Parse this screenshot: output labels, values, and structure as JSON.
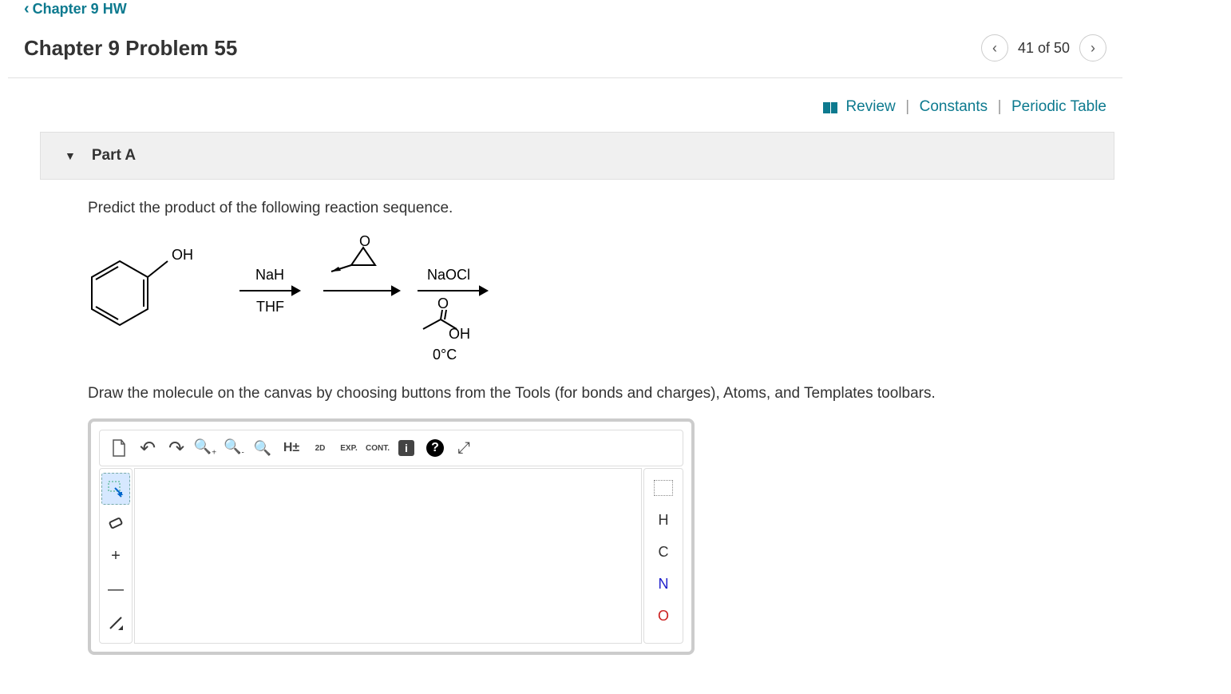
{
  "breadcrumb": "Chapter 9 HW",
  "problem_title": "Chapter 9 Problem 55",
  "nav": {
    "counter": "41 of 50"
  },
  "top_links": {
    "review": "Review",
    "constants": "Constants",
    "periodic": "Periodic Table"
  },
  "part": {
    "title": "Part A"
  },
  "instruction": "Predict the product of the following reaction sequence.",
  "reaction": {
    "reagent1_top": "NaH",
    "reagent1_bottom": "THF",
    "reagent3_top": "NaOCl",
    "reagent3_mid_oh": "OH",
    "reagent3_bottom": "0°C",
    "phenol_oh": "OH",
    "epoxide_o": "O",
    "acid_o": "O"
  },
  "draw_instruction": "Draw the molecule on the canvas by choosing buttons from the Tools (for bonds and charges), Atoms, and Templates toolbars.",
  "toolbar": {
    "h_toggle": "H±",
    "view2d": "2D",
    "exp": "EXP.",
    "cont": "CONT."
  },
  "atoms": {
    "H": "H",
    "C": "C",
    "N": "N",
    "O": "O"
  },
  "left_tools": {
    "plus": "+",
    "minus": "—"
  }
}
